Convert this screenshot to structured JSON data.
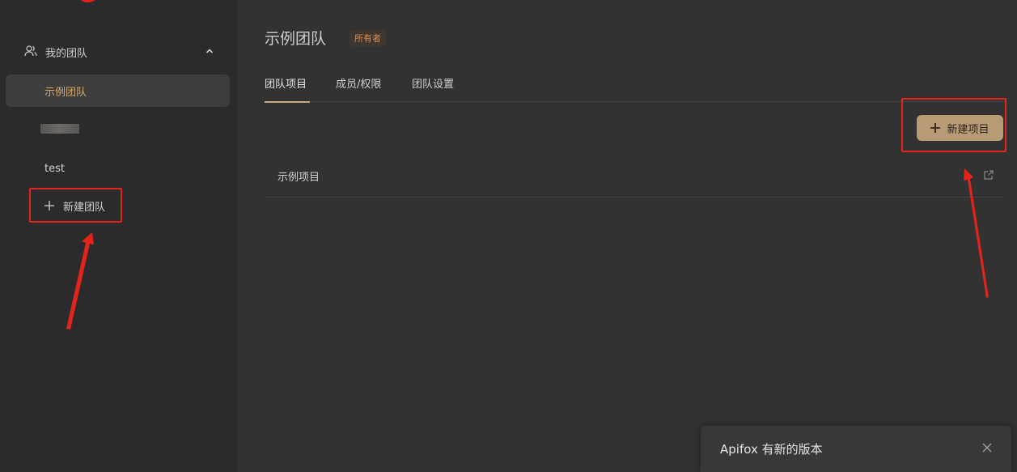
{
  "sidebar": {
    "section_label": "我的团队",
    "section_icon": "team-icon",
    "collapse_icon": "chevron-up-icon",
    "teams": [
      {
        "label": "示例团队",
        "active": true
      },
      {
        "label": "",
        "redacted": true
      },
      {
        "label": "test",
        "active": false
      }
    ],
    "new_team_label": "新建团队"
  },
  "main": {
    "team_title": "示例团队",
    "owner_badge": "所有者",
    "tabs": [
      {
        "label": "团队项目",
        "active": true
      },
      {
        "label": "成员/权限",
        "active": false
      },
      {
        "label": "团队设置",
        "active": false
      }
    ],
    "new_project_label": "新建项目",
    "projects": [
      {
        "name": "示例项目",
        "action_icon": "external-link-icon"
      }
    ]
  },
  "toast": {
    "message": "Apifox 有新的版本",
    "close_icon": "close-icon"
  },
  "colors": {
    "accent": "#c8a97c",
    "active_text": "#d8a86b",
    "annotation": "#e3241b",
    "badge_text": "#d48b52"
  }
}
